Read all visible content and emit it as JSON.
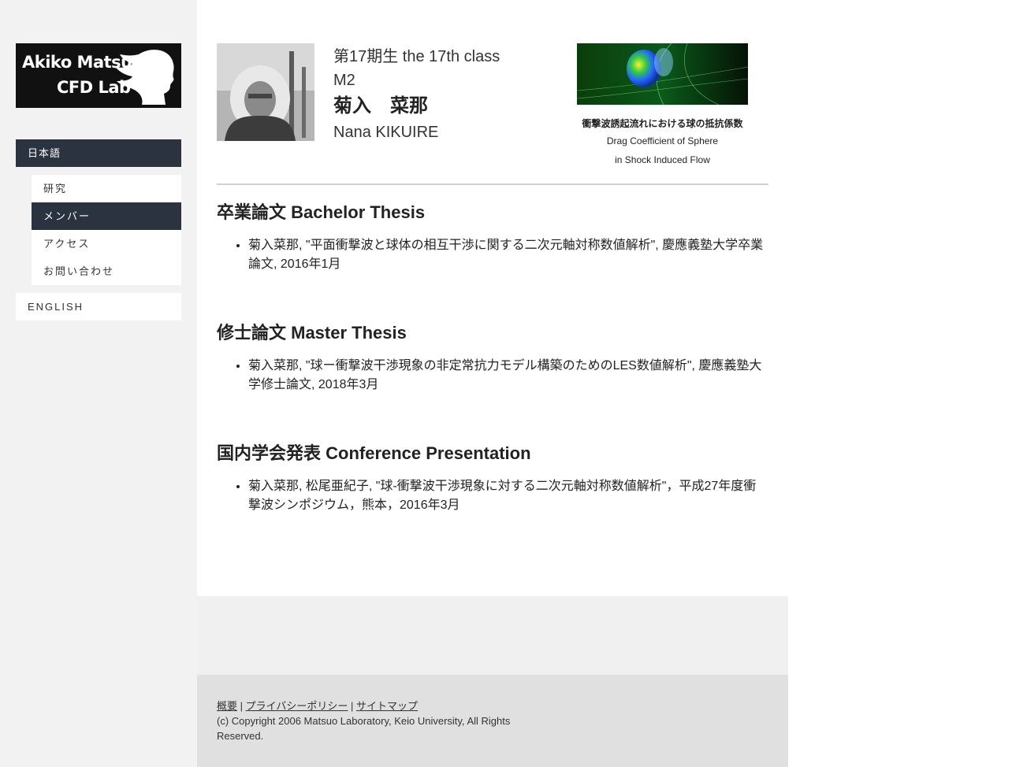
{
  "logo": {
    "line1": "Akiko Matsuo",
    "line2": "CFD Lab"
  },
  "nav": {
    "japanese": "日本語",
    "items": [
      {
        "label": "研究",
        "active": false
      },
      {
        "label": "メンバー",
        "active": true
      },
      {
        "label": "アクセス",
        "active": false
      },
      {
        "label": "お問い合わせ",
        "active": false
      }
    ],
    "english": "ENGLISH"
  },
  "profile": {
    "class": "第17期生 the 17th class",
    "grade": "M2",
    "name_ja": "菊入　菜那",
    "name_en": "Nana KIKUIRE"
  },
  "figure": {
    "caption_ja": "衝撃波誘起流れにおける球の抵抗係数",
    "caption_en_1": "Drag Coefficient of Sphere",
    "caption_en_2": "in Shock Induced Flow"
  },
  "sections": [
    {
      "title": "卒業論文 Bachelor Thesis",
      "items": [
        "菊入菜那, \"平面衝撃波と球体の相互干渉に関する二次元軸対称数値解析\", 慶應義塾大学卒業論文, 2016年1月"
      ]
    },
    {
      "title": "修士論文 Master Thesis",
      "items": [
        "菊入菜那, \"球ー衝撃波干渉現象の非定常抗力モデル構築のためのLES数値解析\", 慶應義塾大学修士論文, 2018年3月"
      ]
    },
    {
      "title": "国内学会発表 Conference Presentation",
      "items": [
        "菊入菜那, 松尾亜紀子, \"球-衝撃波干渉現象に対する二次元軸対称数値解析\"，平成27年度衝撃波シンポジウム，熊本，2016年3月"
      ]
    }
  ],
  "footer": {
    "link_overview": "概要",
    "separator": "|",
    "link_privacy": "プライバシーポリシー",
    "link_sitemap": "サイトマップ",
    "copyright": "(c) Copyright 2006 Matsuo Laboratory, Keio University, All Rights Reserved."
  }
}
